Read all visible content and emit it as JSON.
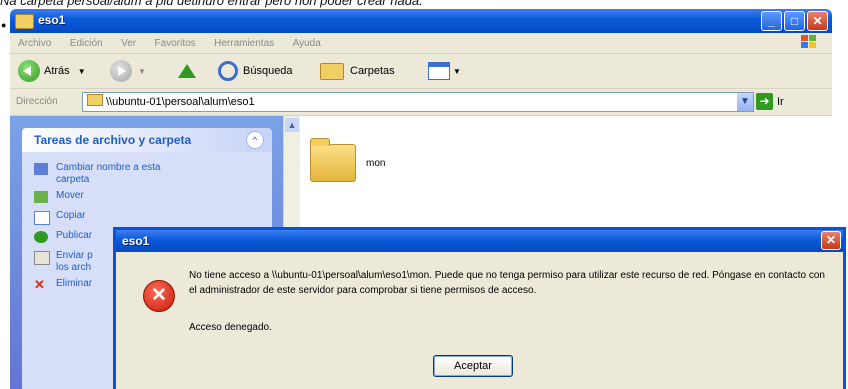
{
  "caption": "Na carpeta persoal/alum a plu detinuro entrar pero non poder crear nada.",
  "explorer": {
    "title": "eso1",
    "menu": [
      "Archivo",
      "Edición",
      "Ver",
      "Favoritos",
      "Herramientas",
      "Ayuda"
    ],
    "toolbar": {
      "back": "Atrás",
      "search": "Búsqueda",
      "folders": "Carpetas"
    },
    "address_label": "Dirección",
    "address_value": "\\\\ubuntu-01\\persoal\\alum\\eso1",
    "go_label": "Ir",
    "tasks_title": "Tareas de archivo y carpeta",
    "tasks": [
      {
        "label": "Cambiar nombre a esta",
        "label2": "carpeta",
        "icon": "rename-icon"
      },
      {
        "label": "Mover",
        "label2": "",
        "icon": "move-icon"
      },
      {
        "label": "Copiar",
        "label2": "",
        "icon": "copy-icon"
      },
      {
        "label": "Publicar",
        "label2": "",
        "icon": "publish-icon"
      },
      {
        "label": "Enviar p",
        "label2": "los arch",
        "icon": "email-icon"
      },
      {
        "label": "Eliminar",
        "label2": "",
        "icon": "delete-icon"
      }
    ],
    "folder_name": "mon"
  },
  "dialog": {
    "title": "eso1",
    "message": "No tiene acceso a \\\\ubuntu-01\\persoal\\alum\\eso1\\mon. Puede que no tenga permiso para utilizar este recurso de red. Póngase en contacto con el administrador de este servidor para comprobar si tiene permisos de acceso.",
    "detail": "Acceso denegado.",
    "ok_label": "Aceptar"
  },
  "colors": {
    "title_blue": "#0a5ad8",
    "close_red": "#c6391a",
    "error_red": "#c21a07",
    "xp_beige": "#ece9d8"
  }
}
